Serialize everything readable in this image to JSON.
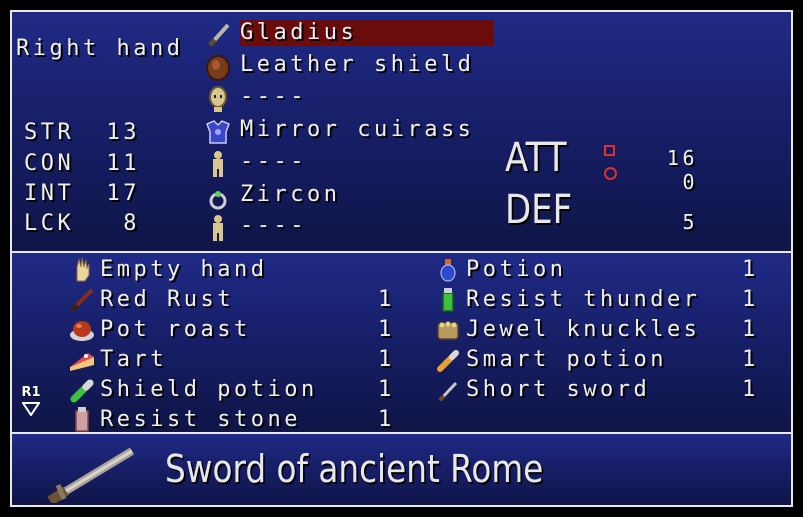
{
  "equip": {
    "hand_label": "Right hand",
    "slots": [
      {
        "name": "Gladius",
        "icon": "sword-icon",
        "selected": true
      },
      {
        "name": "Leather shield",
        "icon": "shield-icon"
      },
      {
        "name": "----",
        "icon": "head-slot-icon"
      },
      {
        "name": "Mirror cuirass",
        "icon": "armor-icon"
      },
      {
        "name": "----",
        "icon": "body-slot-icon"
      },
      {
        "name": "Zircon",
        "icon": "ring-icon"
      },
      {
        "name": "----",
        "icon": "accessory-slot-icon"
      }
    ]
  },
  "stats": [
    {
      "name": "STR",
      "value": "13"
    },
    {
      "name": "CON",
      "value": "11"
    },
    {
      "name": "INT",
      "value": "17"
    },
    {
      "name": "LCK",
      "value": "8"
    }
  ],
  "combat": {
    "att_label": "ATT",
    "def_label": "DEF",
    "att_physical": "16",
    "att_magic": "0",
    "def_value": "5",
    "physical_color": "#e0302c",
    "magic_color": "#e0302c"
  },
  "inventory": {
    "left": [
      {
        "name": "Empty hand",
        "qty": "",
        "icon": "hand-icon"
      },
      {
        "name": "Red Rust",
        "qty": "1",
        "icon": "dagger-icon"
      },
      {
        "name": "Pot roast",
        "qty": "1",
        "icon": "pot-roast-icon"
      },
      {
        "name": "Tart",
        "qty": "1",
        "icon": "tart-icon"
      },
      {
        "name": "Shield potion",
        "qty": "1",
        "icon": "green-potion-icon"
      },
      {
        "name": "Resist stone",
        "qty": "1",
        "icon": "bottle-icon"
      }
    ],
    "right": [
      {
        "name": "Potion",
        "qty": "1",
        "icon": "potion-icon"
      },
      {
        "name": "Resist thunder",
        "qty": "1",
        "icon": "green-bottle-icon"
      },
      {
        "name": "Jewel knuckles",
        "qty": "1",
        "icon": "knuckles-icon"
      },
      {
        "name": "Smart potion",
        "qty": "1",
        "icon": "vial-icon"
      },
      {
        "name": "Short sword",
        "qty": "1",
        "icon": "short-sword-icon"
      }
    ],
    "scroll_button_label": "R1"
  },
  "description": {
    "text": "Sword of ancient Rome",
    "icon": "gladius-large-icon"
  },
  "colors": {
    "panel_top": "#1f2a86",
    "panel_bottom": "#0f1546",
    "selection": "#6a0c0c",
    "border": "#e8e8e8"
  }
}
